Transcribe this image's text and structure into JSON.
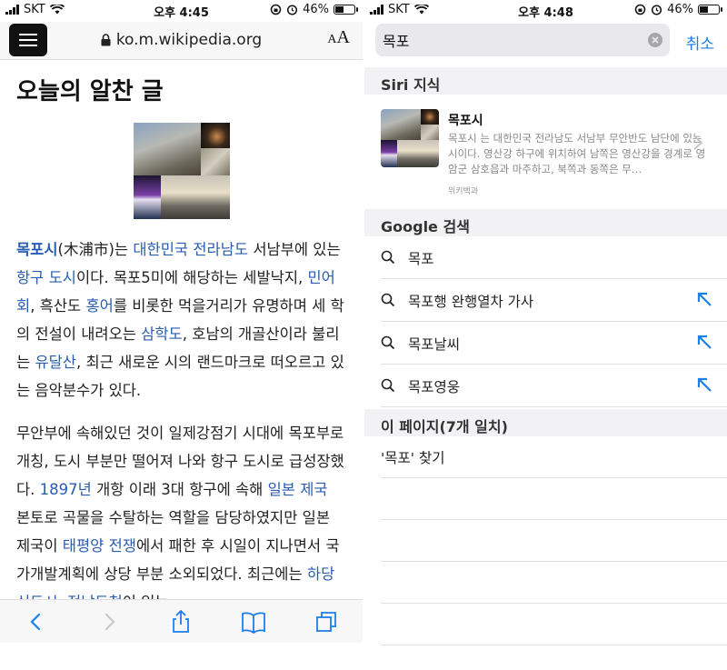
{
  "left": {
    "status": {
      "carrier": "SKT",
      "time": "오후 4:45",
      "battery": "46%",
      "battery_level": 0.46
    },
    "url": "ko.m.wikipedia.org",
    "text_size_label_small": "A",
    "text_size_label_large": "A",
    "article_title": "오늘의 알찬 글",
    "paragraph1": [
      {
        "text": "목포시",
        "link": true,
        "bold": true
      },
      {
        "text": "(木浦市)는 "
      },
      {
        "text": "대한민국",
        "link": true
      },
      {
        "text": " "
      },
      {
        "text": "전라남도",
        "link": true
      },
      {
        "text": " 서남부에 있는 "
      },
      {
        "text": "항구",
        "link": true
      },
      {
        "text": " "
      },
      {
        "text": "도시",
        "link": true
      },
      {
        "text": "이다. 목포5미에 해당하는 세발낙지, "
      },
      {
        "text": "민어회",
        "link": true
      },
      {
        "text": ", 흑산도 "
      },
      {
        "text": "홍어",
        "link": true
      },
      {
        "text": "를 비롯한 먹을거리가 유명하며 세 학의 전설이 내려오는 "
      },
      {
        "text": "삼학도",
        "link": true
      },
      {
        "text": ", 호남의 개골산이라 불리는 "
      },
      {
        "text": "유달산",
        "link": true
      },
      {
        "text": ", 최근 새로운 시의 랜드마크로 떠오르고 있는 음악분수가 있다."
      }
    ],
    "paragraph2": [
      {
        "text": "무안부에 속해있던 것이 일제강점기 시대에 목포부로 개칭, 도시 부분만 떨어져 나와 항구 도시로 급성장했다. "
      },
      {
        "text": "1897년",
        "link": true
      },
      {
        "text": " 개항 이래 3대 항구에 속해 "
      },
      {
        "text": "일본 제국",
        "link": true
      },
      {
        "text": " 본토로 곡물을 수탈하는 역할을 담당하였지만 일본 제국이 "
      },
      {
        "text": "태평양 전쟁",
        "link": true
      },
      {
        "text": "에서 패한 후 시일이 지나면서 국가개발계획에 상당 부분 소외되었다. 최근에는 "
      },
      {
        "text": "하당신도시",
        "link": true
      },
      {
        "text": ", "
      },
      {
        "text": "전남도청",
        "link": true
      },
      {
        "text": "이 있는"
      }
    ],
    "toolbar_icons": [
      "back-icon",
      "forward-icon",
      "share-icon",
      "bookmarks-icon",
      "tabs-icon"
    ]
  },
  "right": {
    "status": {
      "carrier": "SKT",
      "time": "오후 4:48",
      "battery": "46%",
      "battery_level": 0.46
    },
    "search_value": "목포",
    "cancel_label": "취소",
    "siri_header": "Siri 지식",
    "siri_title": "목포시",
    "siri_description": "목포시 는 대한민국 전라남도 서남부 무안반도 남단에 있는 시이다. 영산강 하구에 위치하여 남쪽은 영산강을 경계로 영암군 삼호읍과 마주하고, 북쪽과 동쪽은 무…",
    "siri_source": "위키백과",
    "google_header": "Google 검색",
    "suggestions": [
      {
        "text": "목포",
        "arrow": false
      },
      {
        "text": "목포행 완행열차 가사",
        "arrow": true
      },
      {
        "text": "목포날씨",
        "arrow": true
      },
      {
        "text": "목포영웅",
        "arrow": true
      }
    ],
    "page_header": "이 페이지(7개 일치)",
    "find_on_page": "'목포' 찾기"
  },
  "colors": {
    "link": "#2a5db0",
    "accent": "#1a7fe8",
    "section_bg": "#f2f2f4"
  }
}
